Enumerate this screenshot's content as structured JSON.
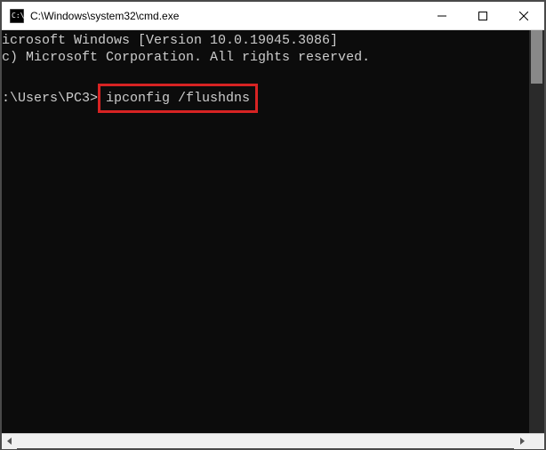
{
  "titlebar": {
    "title": "C:\\Windows\\system32\\cmd.exe"
  },
  "terminal": {
    "line1": "icrosoft Windows [Version 10.0.19045.3086]",
    "line2": "c) Microsoft Corporation. All rights reserved.",
    "prompt_prefix": ":\\Users\\PC3>",
    "command": "ipconfig /flushdns"
  }
}
